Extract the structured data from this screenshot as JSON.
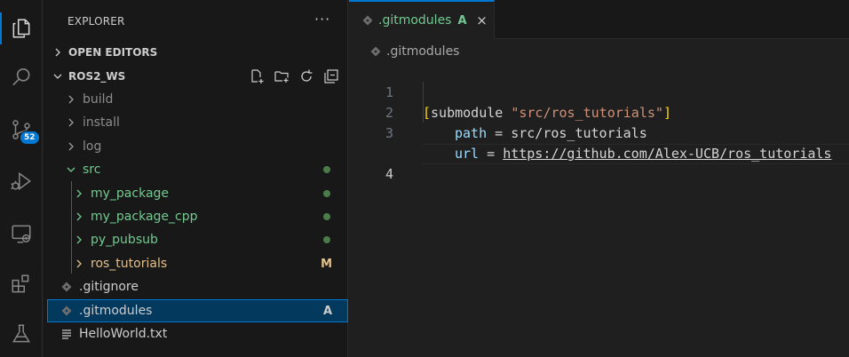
{
  "activity_bar": {
    "items": [
      {
        "name": "explorer-icon"
      },
      {
        "name": "search-icon"
      },
      {
        "name": "source-control-icon",
        "badge": "52"
      },
      {
        "name": "run-debug-icon"
      },
      {
        "name": "remote-explorer-icon"
      },
      {
        "name": "extensions-icon"
      },
      {
        "name": "testing-icon"
      }
    ],
    "accent": "#0078d4"
  },
  "sidebar": {
    "title": "EXPLORER",
    "more": "···",
    "open_editors": "OPEN EDITORS",
    "workspace": "ROS2_WS",
    "tree": [
      {
        "label": "build",
        "type": "folder",
        "expanded": false,
        "status": ""
      },
      {
        "label": "install",
        "type": "folder",
        "expanded": false,
        "status": ""
      },
      {
        "label": "log",
        "type": "folder",
        "expanded": false,
        "status": ""
      },
      {
        "label": "src",
        "type": "folder",
        "expanded": true,
        "status": "dot"
      },
      {
        "label": "my_package",
        "type": "folder",
        "expanded": false,
        "status": "dot"
      },
      {
        "label": "my_package_cpp",
        "type": "folder",
        "expanded": false,
        "status": "dot"
      },
      {
        "label": "py_pubsub",
        "type": "folder",
        "expanded": false,
        "status": "dot"
      },
      {
        "label": "ros_tutorials",
        "type": "folder",
        "expanded": false,
        "status": "M"
      },
      {
        "label": ".gitignore",
        "type": "file",
        "status": ""
      },
      {
        "label": ".gitmodules",
        "type": "file",
        "status": "A"
      },
      {
        "label": "HelloWorld.txt",
        "type": "file",
        "status": ""
      }
    ]
  },
  "editor": {
    "tab": {
      "label": ".gitmodules",
      "status": "A",
      "close": "×"
    },
    "breadcrumb": ".gitmodules",
    "line_numbers": [
      "1",
      "2",
      "3",
      "4"
    ],
    "lines": {
      "l1": {
        "open": "[",
        "section": "submodule ",
        "name": "\"src/ros_tutorials\"",
        "close": "]"
      },
      "l2": {
        "key": "path",
        "eq": " = ",
        "value": "src/ros_tutorials"
      },
      "l3": {
        "key": "url",
        "eq": " = ",
        "value": "https://github.com/Alex-UCB/ros_tutorials"
      }
    }
  }
}
